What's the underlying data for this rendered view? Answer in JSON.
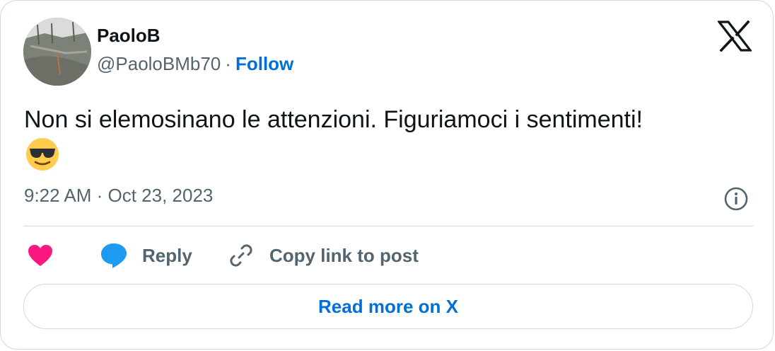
{
  "author": {
    "display_name": "PaoloB",
    "handle": "@PaoloBMb70",
    "separator": "·",
    "follow_label": "Follow"
  },
  "tweet": {
    "text": "Non si elemosinano le attenzioni. Figuriamoci i sentimenti!",
    "emoji": "smiling-face-with-sunglasses",
    "timestamp": "9:22 AM · Oct 23, 2023"
  },
  "actions": {
    "reply_label": "Reply",
    "copy_link_label": "Copy link to post",
    "read_more_label": "Read more on X"
  },
  "colors": {
    "link": "#006fd6",
    "muted": "#536471",
    "heart": "#f91880",
    "reply_bubble": "#1d9bf0",
    "border": "#cfd9de"
  }
}
